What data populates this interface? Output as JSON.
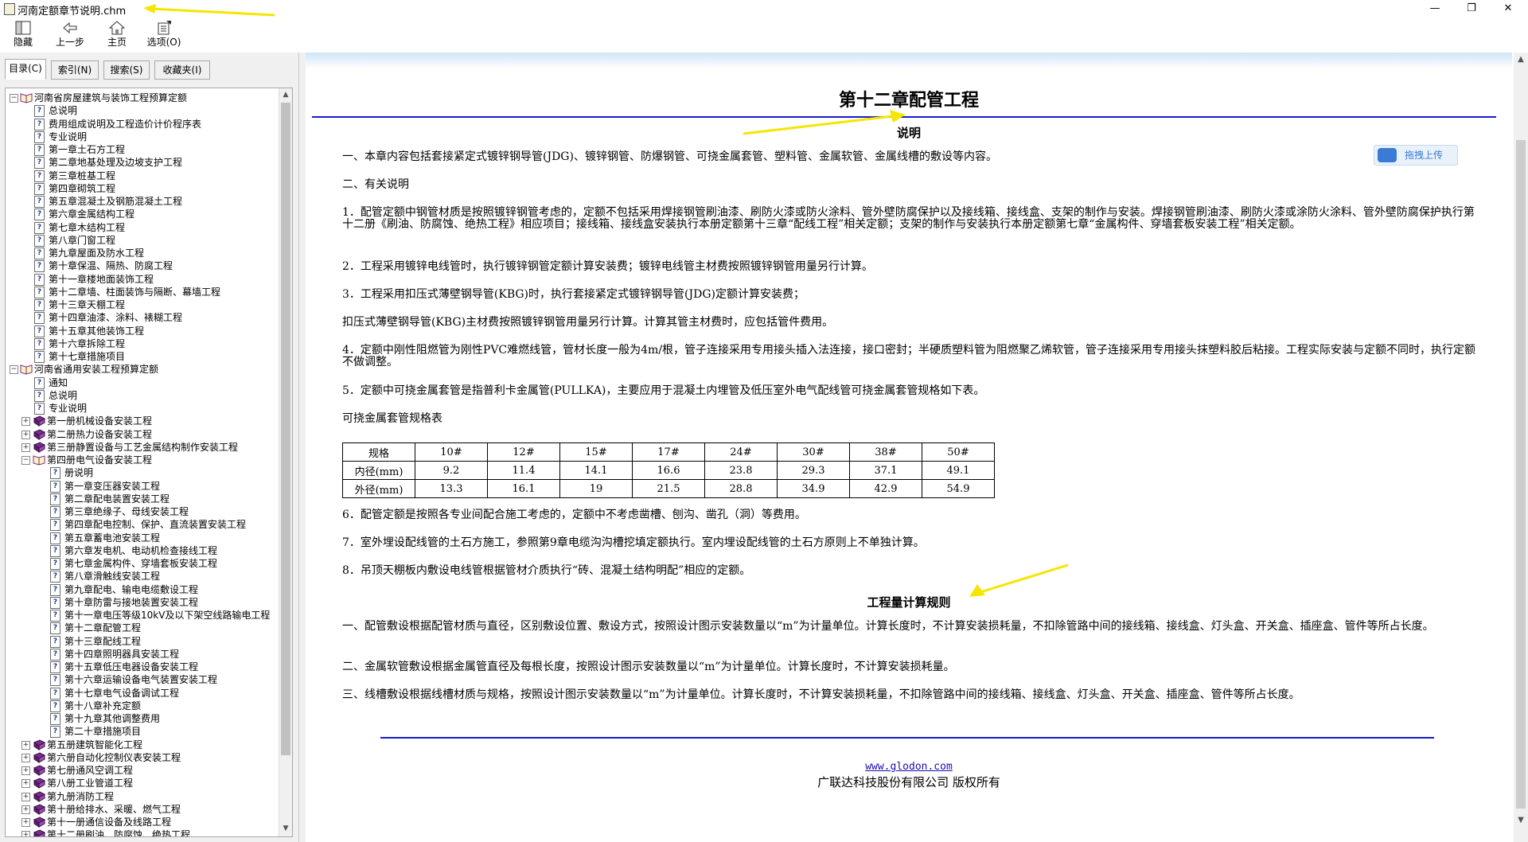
{
  "window": {
    "title": "河南定额章节说明.chm",
    "buttons": {
      "minimize": "—",
      "restore": "❐",
      "close": "✕"
    }
  },
  "toolbar": {
    "hide": "隐藏",
    "back": "上一步",
    "home": "主页",
    "options": "选项(O)"
  },
  "tabs": [
    "目录(C)",
    "索引(N)",
    "搜索(S)",
    "收藏夹(I)"
  ],
  "tree": [
    {
      "level": 0,
      "expander": "−",
      "icon": "book-open",
      "label": "河南省房屋建筑与装饰工程预算定额"
    },
    {
      "level": 1,
      "icon": "page",
      "label": "总说明"
    },
    {
      "level": 1,
      "icon": "page",
      "label": "费用组成说明及工程造价计价程序表"
    },
    {
      "level": 1,
      "icon": "page",
      "label": "专业说明"
    },
    {
      "level": 1,
      "icon": "page",
      "label": "第一章土石方工程"
    },
    {
      "level": 1,
      "icon": "page",
      "label": "第二章地基处理及边坡支护工程"
    },
    {
      "level": 1,
      "icon": "page",
      "label": "第三章桩基工程"
    },
    {
      "level": 1,
      "icon": "page",
      "label": "第四章砌筑工程"
    },
    {
      "level": 1,
      "icon": "page",
      "label": "第五章混凝土及钢筋混凝土工程"
    },
    {
      "level": 1,
      "icon": "page",
      "label": "第六章金属结构工程"
    },
    {
      "level": 1,
      "icon": "page",
      "label": "第七章木结构工程"
    },
    {
      "level": 1,
      "icon": "page",
      "label": "第八章门窗工程"
    },
    {
      "level": 1,
      "icon": "page",
      "label": "第九章屋面及防水工程"
    },
    {
      "level": 1,
      "icon": "page",
      "label": "第十章保温、隔热、防腐工程"
    },
    {
      "level": 1,
      "icon": "page",
      "label": "第十一章楼地面装饰工程"
    },
    {
      "level": 1,
      "icon": "page",
      "label": "第十二章墙、柱面装饰与隔断、幕墙工程"
    },
    {
      "level": 1,
      "icon": "page",
      "label": "第十三章天棚工程"
    },
    {
      "level": 1,
      "icon": "page",
      "label": "第十四章油漆、涂料、裱糊工程"
    },
    {
      "level": 1,
      "icon": "page",
      "label": "第十五章其他装饰工程"
    },
    {
      "level": 1,
      "icon": "page",
      "label": "第十六章拆除工程"
    },
    {
      "level": 1,
      "icon": "page",
      "label": "第十七章措施项目"
    },
    {
      "level": 0,
      "expander": "−",
      "icon": "book-open",
      "label": "河南省通用安装工程预算定额"
    },
    {
      "level": 1,
      "icon": "page",
      "label": "通知"
    },
    {
      "level": 1,
      "icon": "page",
      "label": "总说明"
    },
    {
      "level": 1,
      "icon": "page",
      "label": "专业说明"
    },
    {
      "level": 1,
      "expander": "+",
      "icon": "book",
      "label": "第一册机械设备安装工程"
    },
    {
      "level": 1,
      "expander": "+",
      "icon": "book",
      "label": "第二册热力设备安装工程"
    },
    {
      "level": 1,
      "expander": "+",
      "icon": "book",
      "label": "第三册静置设备与工艺金属结构制作安装工程"
    },
    {
      "level": 1,
      "expander": "−",
      "icon": "book-open",
      "label": "第四册电气设备安装工程"
    },
    {
      "level": 2,
      "icon": "page",
      "label": "册说明"
    },
    {
      "level": 2,
      "icon": "page",
      "label": "第一章变压器安装工程"
    },
    {
      "level": 2,
      "icon": "page",
      "label": "第二章配电装置安装工程"
    },
    {
      "level": 2,
      "icon": "page",
      "label": "第三章绝缘子、母线安装工程"
    },
    {
      "level": 2,
      "icon": "page",
      "label": "第四章配电控制、保护、直流装置安装工程"
    },
    {
      "level": 2,
      "icon": "page",
      "label": "第五章蓄电池安装工程"
    },
    {
      "level": 2,
      "icon": "page",
      "label": "第六章发电机、电动机检查接线工程"
    },
    {
      "level": 2,
      "icon": "page",
      "label": "第七章金属构件、穿墙套板安装工程"
    },
    {
      "level": 2,
      "icon": "page",
      "label": "第八章滑触线安装工程"
    },
    {
      "level": 2,
      "icon": "page",
      "label": "第九章配电、输电电缆敷设工程"
    },
    {
      "level": 2,
      "icon": "page",
      "label": "第十章防雷与接地装置安装工程"
    },
    {
      "level": 2,
      "icon": "page",
      "label": "第十一章电压等级10kV及以下架空线路输电工程"
    },
    {
      "level": 2,
      "icon": "page",
      "label": "第十二章配管工程"
    },
    {
      "level": 2,
      "icon": "page",
      "label": "第十三章配线工程"
    },
    {
      "level": 2,
      "icon": "page",
      "label": "第十四章照明器具安装工程"
    },
    {
      "level": 2,
      "icon": "page",
      "label": "第十五章低压电器设备安装工程"
    },
    {
      "level": 2,
      "icon": "page",
      "label": "第十六章运输设备电气装置安装工程"
    },
    {
      "level": 2,
      "icon": "page",
      "label": "第十七章电气设备调试工程"
    },
    {
      "level": 2,
      "icon": "page",
      "label": "第十八章补充定额"
    },
    {
      "level": 2,
      "icon": "page",
      "label": "第十九章其他调整费用"
    },
    {
      "level": 2,
      "icon": "page",
      "label": "第二十章措施项目"
    },
    {
      "level": 1,
      "expander": "+",
      "icon": "book",
      "label": "第五册建筑智能化工程"
    },
    {
      "level": 1,
      "expander": "+",
      "icon": "book",
      "label": "第六册自动化控制仪表安装工程"
    },
    {
      "level": 1,
      "expander": "+",
      "icon": "book",
      "label": "第七册通风空调工程"
    },
    {
      "level": 1,
      "expander": "+",
      "icon": "book",
      "label": "第八册工业管道工程"
    },
    {
      "level": 1,
      "expander": "+",
      "icon": "book",
      "label": "第九册消防工程"
    },
    {
      "level": 1,
      "expander": "+",
      "icon": "book",
      "label": "第十册给排水、采暖、燃气工程"
    },
    {
      "level": 1,
      "expander": "+",
      "icon": "book",
      "label": "第十一册通信设备及线路工程"
    },
    {
      "level": 1,
      "expander": "+",
      "icon": "book",
      "label": "第十二册刷油、防腐蚀、绝热工程"
    }
  ],
  "content": {
    "title": "第十二章配管工程",
    "subtitle": "说明",
    "upload_label": "拖拽上传",
    "paragraphs": [
      "一、本章内容包括套接紧定式镀锌钢导管(JDG)、镀锌钢管、防爆钢管、可挠金属套管、塑料管、金属软管、金属线槽的敷设等内容。",
      "二、有关说明",
      "1．配管定额中钢管材质是按照镀锌钢管考虑的，定额不包括采用焊接钢管刷油漆、刷防火漆或防火涂料、管外壁防腐保护以及接线箱、接线盒、支架的制作与安装。焊接钢管刷油漆、刷防火漆或涂防火涂料、管外壁防腐保护执行第十二册《刷油、防腐蚀、绝热工程》相应项目；接线箱、接线盒安装执行本册定额第十三章“配线工程”相关定额；支架的制作与安装执行本册定额第七章“金属构件、穿墙套板安装工程”相关定额。",
      "2．工程采用镀锌电线管时，执行镀锌钢管定额计算安装费；镀锌电线管主材费按照镀锌钢管用量另行计算。",
      "3．工程采用扣压式薄壁钢导管(KBG)时，执行套接紧定式镀锌钢导管(JDG)定额计算安装费；",
      "扣压式薄壁钢导管(KBG)主材费按照镀锌钢管用量另行计算。计算其管主材费时，应包括管件费用。",
      "4．定额中刚性阻燃管为刚性PVC难燃线管，管材长度一般为4m/根，管子连接采用专用接头插入法连接，接口密封；半硬质塑料管为阻燃聚乙烯软管，管子连接采用专用接头抹塑料胶后粘接。工程实际安装与定额不同时，执行定额不做调整。",
      "5．定额中可挠金属套管是指普利卡金属管(PULLKA)，主要应用于混凝土内埋管及低压室外电气配线管可挠金属套管规格如下表。",
      "可挠金属套管规格表",
      "6．配管定额是按照各专业间配合施工考虑的，定额中不考虑凿槽、刨沟、凿孔（洞）等费用。",
      "7．室外埋设配线管的土石方施工，参照第9章电缆沟沟槽挖填定额执行。室内埋设配线管的土石方原则上不单独计算。",
      "8．吊顶天棚板内敷设电线管根据管材介质执行“砖、混凝土结构明配”相应的定额。"
    ],
    "rules_title": "工程量计算规则",
    "rules": [
      "一、配管敷设根据配管材质与直径，区别敷设位置、敷设方式，按照设计图示安装数量以“m”为计量单位。计算长度时，不计算安装损耗量，不扣除管路中间的接线箱、接线盒、灯头盒、开关盒、插座盒、管件等所占长度。",
      "二、金属软管敷设根据金属管直径及每根长度，按照设计图示安装数量以“m”为计量单位。计算长度时，不计算安装损耗量。",
      "三、线槽敷设根据线槽材质与规格，按照设计图示安装数量以“m”为计量单位。计算长度时，不计算安装损耗量，不扣除管路中间的接线箱、接线盒、灯头盒、开关盒、插座盒、管件等所占长度。"
    ],
    "spec_table": {
      "rows": [
        [
          "规格",
          "10#",
          "12#",
          "15#",
          "17#",
          "24#",
          "30#",
          "38#",
          "50#"
        ],
        [
          "内径(mm)",
          "9.2",
          "11.4",
          "14.1",
          "16.6",
          "23.8",
          "29.3",
          "37.1",
          "49.1"
        ],
        [
          "外径(mm)",
          "13.3",
          "16.1",
          "19",
          "21.5",
          "28.8",
          "34.9",
          "42.9",
          "54.9"
        ]
      ]
    },
    "footer_link": "www.glodon.com",
    "footer_copy": "广联达科技股份有限公司 版权所有"
  },
  "colors": {
    "accent_line": "#1a1acc",
    "annotation_arrow": "#f5e600",
    "book_icon": "#7a2e8c"
  }
}
